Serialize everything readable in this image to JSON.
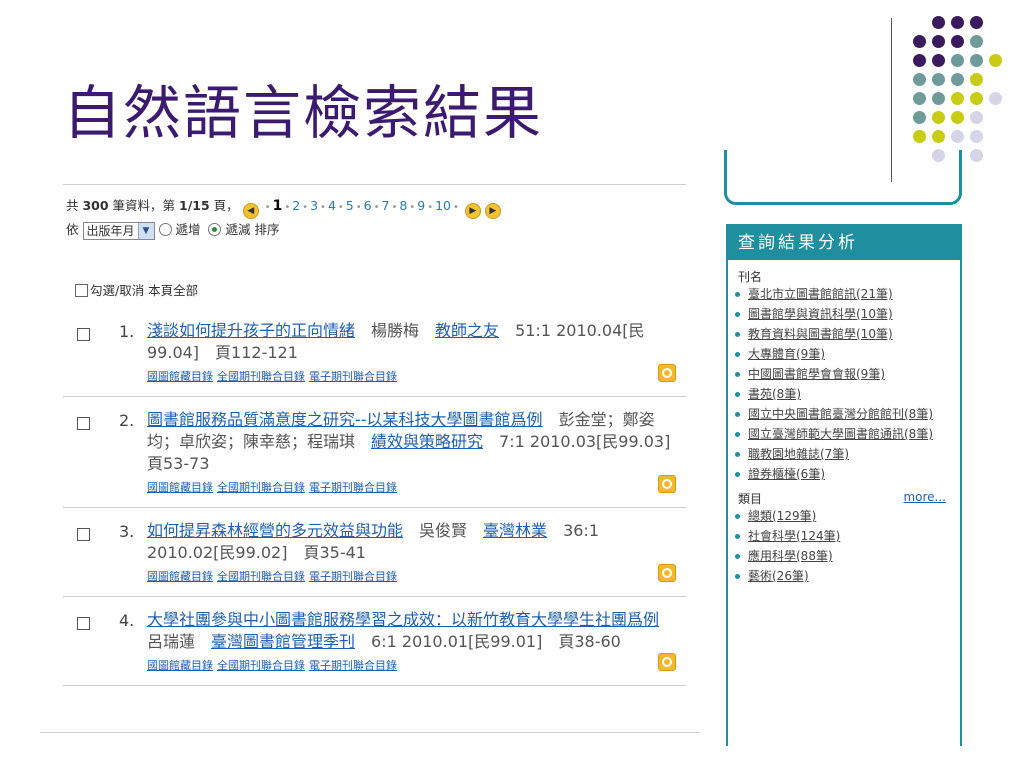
{
  "slide": {
    "title": "自然語言檢索結果"
  },
  "summary": {
    "prefix": "共 ",
    "total": "300",
    "mid": " 筆資料，第 ",
    "page": "1/15",
    "suffix": " 頁，",
    "pages": [
      "1",
      "2",
      "3",
      "4",
      "5",
      "6",
      "7",
      "8",
      "9",
      "10"
    ]
  },
  "sort": {
    "label_prefix": "依",
    "field": "出版年月",
    "asc": "遞增",
    "desc": "遞減",
    "suffix": "排序"
  },
  "select_all": "勾選/取消 本頁全部",
  "records": [
    {
      "num": "1.",
      "title": "淺談如何提升孩子的正向情緒",
      "author": "楊勝梅",
      "journal": "教師之友",
      "rest": "51:1 2010.04[民99.04]　頁112-121",
      "links": [
        "國圖館藏目錄",
        "全國期刊聯合目錄",
        "電子期刊聯合目錄"
      ]
    },
    {
      "num": "2.",
      "title": "圖書館服務品質滿意度之研究--以某科技大學圖書館爲例",
      "author": "彭金堂；鄭姿均；卓欣姿；陳幸慈；程瑞琪",
      "journal": "績效與策略研究",
      "rest": "7:1 2010.03[民99.03]　頁53-73",
      "links": [
        "國圖館藏目錄",
        "全國期刊聯合目錄",
        "電子期刊聯合目錄"
      ]
    },
    {
      "num": "3.",
      "title": "如何提昇森林經營的多元效益與功能",
      "author": "吳俊賢",
      "journal": "臺灣林業",
      "rest": "36:1 2010.02[民99.02]　頁35-41",
      "links": [
        "國圖館藏目錄",
        "全國期刊聯合目錄",
        "電子期刊聯合目錄"
      ]
    },
    {
      "num": "4.",
      "title": "大學社團參與中小圖書館服務學習之成效：以新竹教育大學學生社團爲例",
      "author": "呂瑞蓮",
      "journal": "臺灣圖書館管理季刊",
      "rest": "6:1 2010.01[民99.01]　頁38-60",
      "links": [
        "國圖館藏目錄",
        "全國期刊聯合目錄",
        "電子期刊聯合目錄"
      ]
    }
  ],
  "analysis": {
    "title": "查詢結果分析",
    "journals_label": "刊名",
    "journals": [
      "臺北市立圖書館館訊(21筆)",
      "圖書館學與資訊科學(10筆)",
      "教育資料與圖書館學(10筆)",
      "大專體育(9筆)",
      "中國圖書館學會會報(9筆)",
      "書苑(8筆)",
      "國立中央圖書館臺灣分館館刊(8筆)",
      "國立臺灣師範大學圖書館通訊(8筆)",
      "職教園地雜誌(7筆)",
      "證券櫃檯(6筆)"
    ],
    "categories_label": "類目",
    "more_label": "more...",
    "categories": [
      "總類(129筆)",
      "社會科學(124筆)",
      "應用科學(88筆)",
      "藝術(26筆)"
    ]
  },
  "colors": {
    "title": "#3b1a70",
    "accent": "#1f8fa0",
    "link": "#1f5fb0",
    "dot_purple": "#3b1a5e",
    "dot_teal": "#6f9b9b",
    "dot_yellow": "#c8cc14",
    "dot_lavender": "#d5d5e8"
  }
}
